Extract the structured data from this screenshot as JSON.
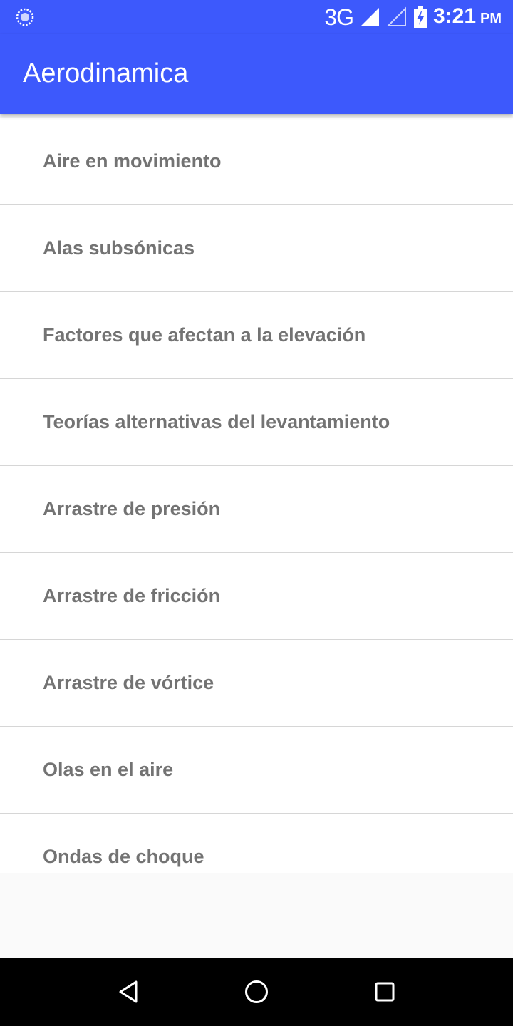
{
  "status_bar": {
    "network": "3G",
    "time": "3:21",
    "ampm": "PM",
    "icons": [
      "sync-icon",
      "signal-icon",
      "signal-empty-icon",
      "battery-charging-icon"
    ]
  },
  "app_bar": {
    "title": "Aerodinamica"
  },
  "list": {
    "items": [
      {
        "label": "Aire en movimiento"
      },
      {
        "label": "Alas subsónicas"
      },
      {
        "label": "Factores que afectan a la elevación"
      },
      {
        "label": "Teorías alternativas del levantamiento"
      },
      {
        "label": "Arrastre de presión"
      },
      {
        "label": "Arrastre de fricción"
      },
      {
        "label": "Arrastre de vórtice"
      },
      {
        "label": "Olas en el aire"
      },
      {
        "label": "Ondas de choque"
      }
    ]
  },
  "nav_bar": {
    "icons": [
      "back-icon",
      "home-icon",
      "recents-icon"
    ]
  },
  "colors": {
    "primary": "#3d59fc",
    "item_text": "#737373",
    "divider": "#d6d6d6"
  }
}
